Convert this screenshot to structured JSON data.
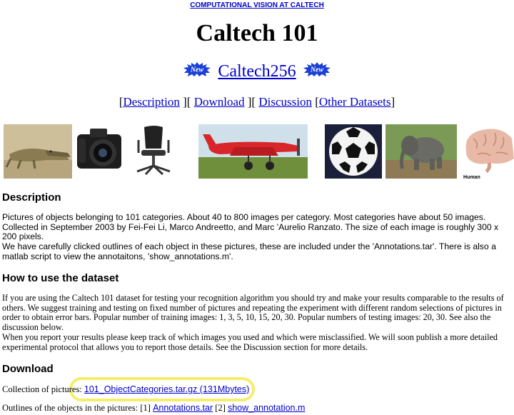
{
  "header": {
    "top_link": "COMPUTATIONAL VISION AT CALTECH",
    "title": "Caltech 101",
    "badge_text": "New",
    "caltech256_link": "Caltech256"
  },
  "nav": {
    "open1": "[",
    "description": "Description",
    "sep1": "][",
    "download": "Download",
    "sep2": "][",
    "discussion": "Discussion",
    "sep3": "[",
    "other_datasets": "Other Datasets",
    "close": "]"
  },
  "image_strip": {
    "items": [
      "crocodile",
      "camera",
      "chair",
      "airplane",
      "soccer-ball",
      "elephant",
      "brain"
    ],
    "brain_caption": "Human"
  },
  "description": {
    "heading": "Description",
    "line1": "Pictures of objects belonging to 101 categories. About 40 to 800 images per category. Most categories have about 50 images. Collected in September 2003 by Fei-Fei Li, Marco Andreetto, and Marc 'Aurelio Ranzato.  The size of each image is roughly 300 x 200 pixels.",
    "line2": "We have carefully clicked outlines of each object in these pictures, these are included under the 'Annotations.tar'. There is also a matlab script to view the annotaitons, 'show_annotations.m'."
  },
  "howto": {
    "heading": "How to use the dataset",
    "line1": "If you are using the Caltech 101 dataset for testing your recognition algorithm you should try and make your results comparable to the results of others. We suggest training and testing on fixed number of pictures and repeating the experiment with different random selections of pictures in order to obtain error bars. Popular number of training images: 1, 3, 5, 10, 15, 20, 30. Popular numbers of testing images: 20, 30. See also the discussion below.",
    "line2": "When you report your results please keep track of which images you used and which were misclassified. We will soon publish a more detailed experimental protocol that allows you to report those details. See the Discussion section for more details."
  },
  "download": {
    "heading": "Download",
    "collection_label": "Collection of pictures:",
    "collection_link": "101_ObjectCategories.tar.gz (131Mbytes)",
    "outlines_label": "Outlines of the objects in the pictures:",
    "marker1": "[1]",
    "annotations_link": "Annotations.tar",
    "marker2": "[2]",
    "show_annotation_link": "show_annotation.m"
  },
  "colors": {
    "link": "#0000cc",
    "badge": "#1a3fd6",
    "highlight": "#f6ee6a",
    "airplane": "#d8262b"
  }
}
